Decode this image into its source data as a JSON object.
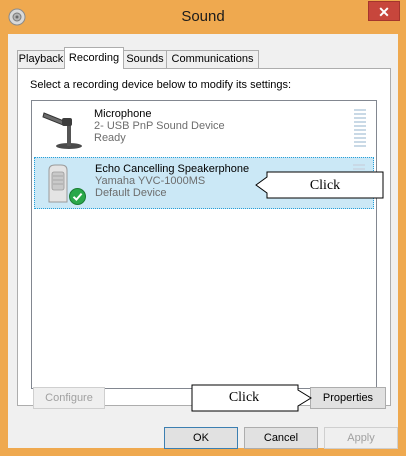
{
  "window": {
    "title": "Sound",
    "close_glyph": "✕",
    "icon": "speaker-icon"
  },
  "tabs": [
    {
      "label": "Playback",
      "active": false
    },
    {
      "label": "Recording",
      "active": true
    },
    {
      "label": "Sounds",
      "active": false
    },
    {
      "label": "Communications",
      "active": false
    }
  ],
  "instruction": "Select a recording device below to modify its settings:",
  "devices": [
    {
      "name": "Microphone",
      "description": "2- USB PnP Sound Device",
      "status": "Ready",
      "selected": false,
      "icon": "microphone-icon"
    },
    {
      "name": "Echo Cancelling Speakerphone",
      "description": "Yamaha YVC-1000MS",
      "status": "Default Device",
      "selected": true,
      "icon": "speakerphone-icon",
      "badge": "default-check-icon"
    }
  ],
  "callouts": [
    {
      "text": "Click"
    },
    {
      "text": "Click"
    }
  ],
  "buttons": {
    "configure": "Configure",
    "properties": "Properties",
    "ok": "OK",
    "cancel": "Cancel",
    "apply": "Apply"
  },
  "colors": {
    "title_bar": "#efa94f",
    "close": "#c7463c",
    "selection": "#cbe8f6",
    "check": "#2aa84a"
  }
}
